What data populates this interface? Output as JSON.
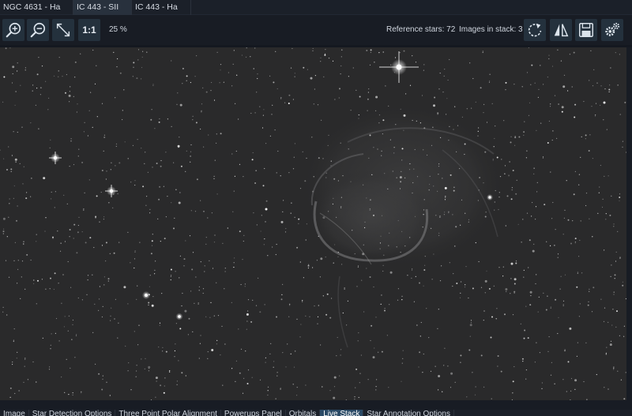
{
  "tabs": [
    {
      "label": "NGC 4631 - Ha",
      "active": false
    },
    {
      "label": "IC 443 - SII",
      "active": true
    },
    {
      "label": "IC 443 - Ha",
      "active": false
    }
  ],
  "toolbar": {
    "zoom_in_icon": "zoom-in-icon",
    "zoom_out_icon": "zoom-out-icon",
    "fit_icon": "fit-to-window-icon",
    "one_to_one_label": "1:1",
    "zoom_level": "25 %",
    "reference_stars": "Reference stars: 72",
    "images_in_stack": "Images in stack: 3",
    "rotate_icon": "rotate-icon",
    "flip_icon": "flip-icon",
    "save_icon": "save-icon",
    "settings_icon": "settings-gears-icon"
  },
  "bottom_tabs": [
    {
      "label": "Image",
      "active": false
    },
    {
      "label": "Star Detection Options",
      "active": false
    },
    {
      "label": "Three Point Polar Alignment",
      "active": false
    },
    {
      "label": "Powerups Panel",
      "active": false
    },
    {
      "label": "Orbitals",
      "active": false
    },
    {
      "label": "Live Stack",
      "active": true
    },
    {
      "label": "Star Annotation Options",
      "active": false
    }
  ],
  "colors": {
    "background": "#141820",
    "toolbar": "#181c24",
    "button": "#24313d",
    "active_tab": "#28313d",
    "active_bottom_tab": "#2a4a66"
  }
}
